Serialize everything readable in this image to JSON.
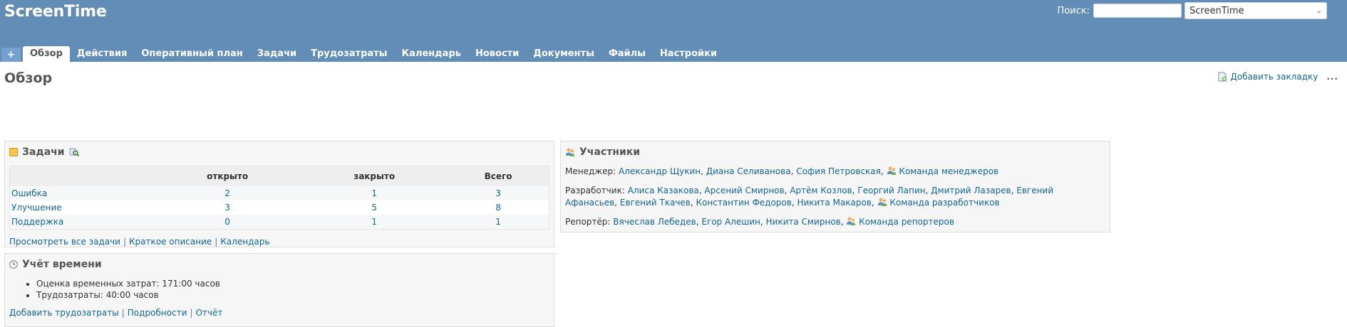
{
  "header": {
    "app_title": "ScreenTime",
    "search_label": "Поиск:",
    "search_value": "",
    "project_select_value": "ScreenTime"
  },
  "menu": {
    "plus": "+",
    "tabs": [
      "Обзор",
      "Действия",
      "Оперативный план",
      "Задачи",
      "Трудозатраты",
      "Календарь",
      "Новости",
      "Документы",
      "Файлы",
      "Настройки"
    ],
    "selected": "Обзор"
  },
  "page": {
    "title": "Обзор",
    "bookmark_label": "Добавить закладку",
    "more": "..."
  },
  "issues_box": {
    "title": "Задачи",
    "columns": [
      "",
      "открыто",
      "закрыто",
      "Всего"
    ],
    "rows": [
      {
        "name": "Ошибка",
        "open": "2",
        "closed": "1",
        "total": "3"
      },
      {
        "name": "Улучшение",
        "open": "3",
        "closed": "5",
        "total": "8"
      },
      {
        "name": "Поддержка",
        "open": "0",
        "closed": "1",
        "total": "1"
      }
    ],
    "links": [
      "Просмотреть все задачи",
      "Краткое описание",
      "Календарь"
    ]
  },
  "time_box": {
    "title": "Учёт времени",
    "items": [
      "Оценка временных затрат: 171:00 часов",
      "Трудозатраты: 40:00 часов"
    ],
    "links": [
      "Добавить трудозатраты",
      "Подробности",
      "Отчёт"
    ]
  },
  "members_box": {
    "title": "Участники",
    "roles": [
      {
        "role": "Менеджер:",
        "people": [
          "Александр Щукин",
          "Диана Селиванова",
          "София Петровская"
        ],
        "group": "Команда менеджеров"
      },
      {
        "role": "Разработчик:",
        "people": [
          "Алиса Казакова",
          "Арсений Смирнов",
          "Артём Козлов",
          "Георгий Лапин",
          "Дмитрий Лазарев",
          "Евгений Афанасьев",
          "Евгений Ткачев",
          "Константин Федоров",
          "Никита Макаров"
        ],
        "group": "Команда разработчиков"
      },
      {
        "role": "Репортёр:",
        "people": [
          "Вячеслав Лебедев",
          "Егор Алешин",
          "Никита Смирнов"
        ],
        "group": "Команда репортеров"
      }
    ]
  }
}
